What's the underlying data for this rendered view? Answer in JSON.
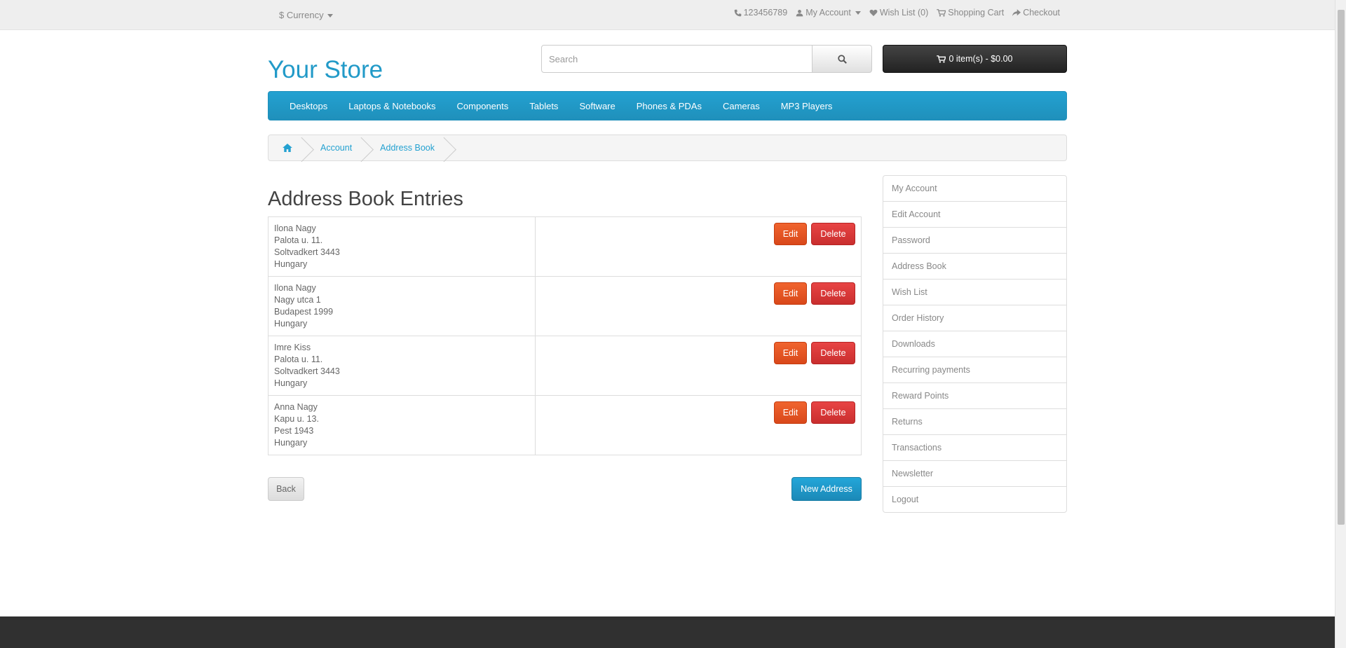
{
  "topbar": {
    "currency_label": "$ Currency",
    "phone": "123456789",
    "my_account": "My Account",
    "wish_list": "Wish List (0)",
    "shopping_cart": "Shopping Cart",
    "checkout": "Checkout"
  },
  "header": {
    "logo": "Your Store",
    "search_placeholder": "Search",
    "cart_button": "0 item(s) - $0.00"
  },
  "menu": {
    "items": [
      "Desktops",
      "Laptops & Notebooks",
      "Components",
      "Tablets",
      "Software",
      "Phones & PDAs",
      "Cameras",
      "MP3 Players"
    ]
  },
  "breadcrumb": {
    "items": [
      "Account",
      "Address Book"
    ]
  },
  "content": {
    "title": "Address Book Entries",
    "edit_label": "Edit",
    "delete_label": "Delete",
    "addresses": [
      {
        "line1": "Ilona Nagy",
        "line2": "Palota u. 11.",
        "line3": "Soltvadkert 3443",
        "line4": "Hungary"
      },
      {
        "line1": "Ilona Nagy",
        "line2": "Nagy utca 1",
        "line3": "Budapest 1999",
        "line4": "Hungary"
      },
      {
        "line1": "Imre Kiss",
        "line2": "Palota u. 11.",
        "line3": "Soltvadkert 3443",
        "line4": "Hungary"
      },
      {
        "line1": "Anna Nagy",
        "line2": "Kapu u. 13.",
        "line3": "Pest 1943",
        "line4": "Hungary"
      }
    ],
    "back_label": "Back",
    "new_address_label": "New Address"
  },
  "sidebar": {
    "items": [
      "My Account",
      "Edit Account",
      "Password",
      "Address Book",
      "Wish List",
      "Order History",
      "Downloads",
      "Recurring payments",
      "Reward Points",
      "Returns",
      "Transactions",
      "Newsletter",
      "Logout"
    ]
  },
  "colors": {
    "accent": "#229ac8",
    "edit": "#e2562a",
    "delete": "#d43f3a",
    "footer": "#303030"
  }
}
